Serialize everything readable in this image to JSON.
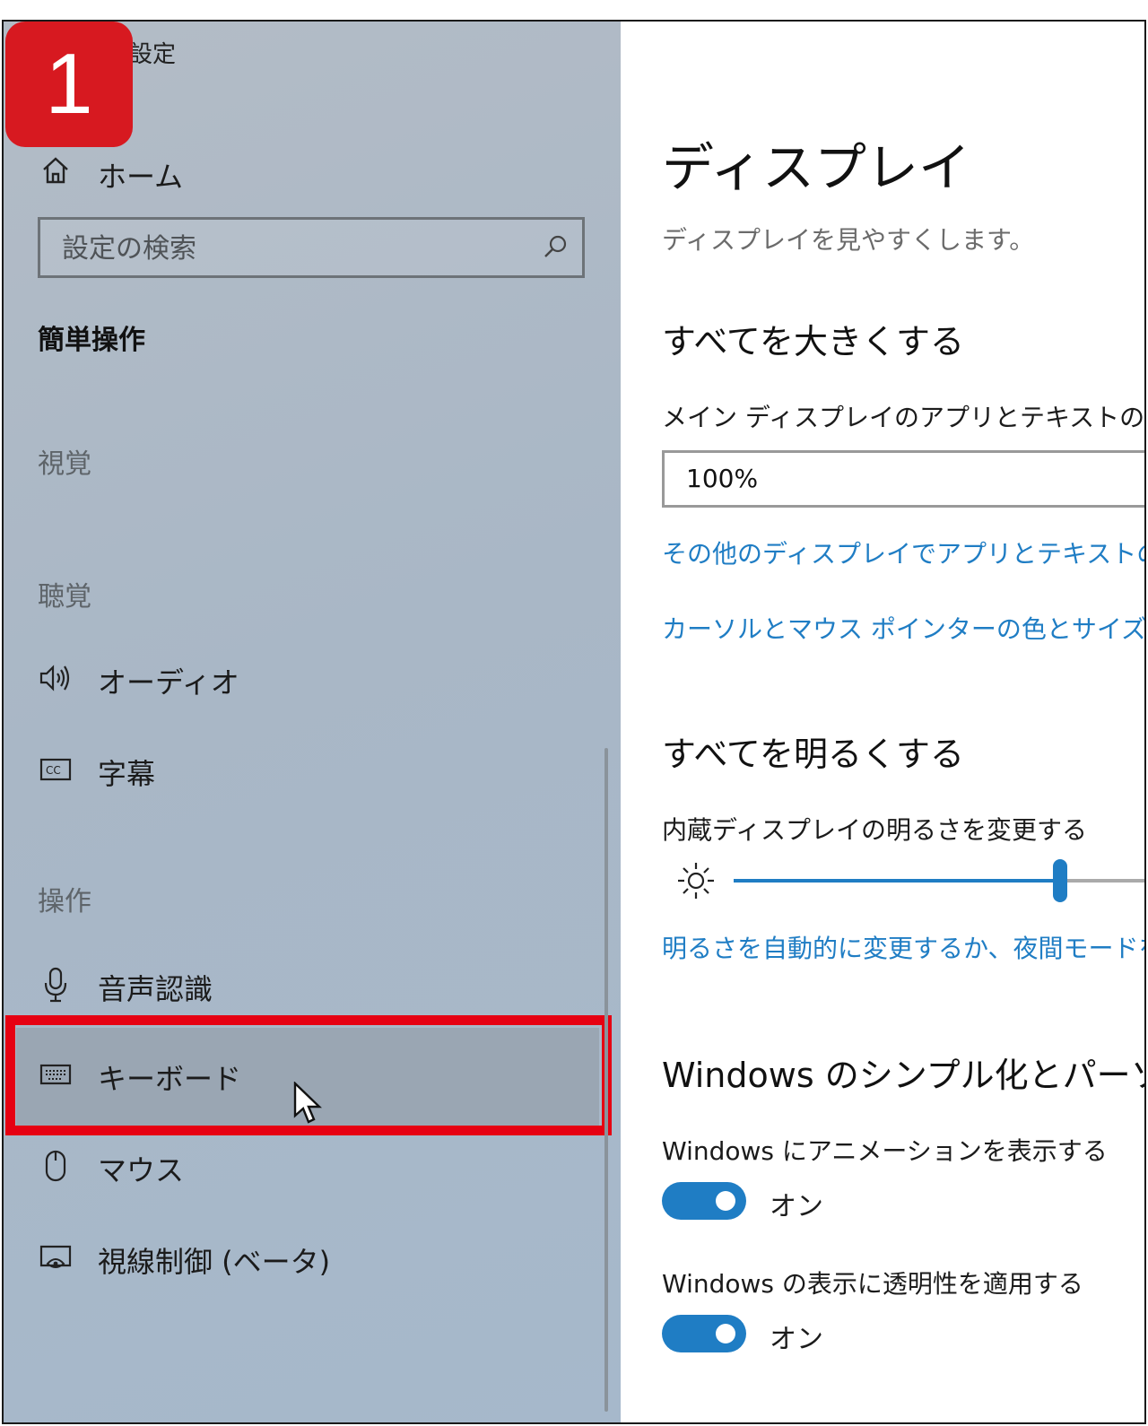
{
  "badge": {
    "number": "1"
  },
  "sidebar": {
    "app_title": "設定",
    "home_label": "ホーム",
    "search_placeholder": "設定の検索",
    "section_title": "簡単操作",
    "groups": {
      "vision": "視覚",
      "hearing": "聴覚",
      "interaction": "操作"
    },
    "items": {
      "audio": "オーディオ",
      "captions": "字幕",
      "speech": "音声認識",
      "keyboard": "キーボード",
      "mouse": "マウス",
      "eye_control": "視線制御 (ベータ)"
    },
    "selected_item": "keyboard"
  },
  "content": {
    "title": "ディスプレイ",
    "subtitle": "ディスプレイを見やすくします。",
    "make_bigger": {
      "heading": "すべてを大きくする",
      "label": "メイン ディスプレイのアプリとテキストのサイズ",
      "value": "100%",
      "link1": "その他のディスプレイでアプリとテキストのサイ",
      "link2": "カーソルとマウス ポインターの色とサイズを変"
    },
    "make_brighter": {
      "heading": "すべてを明るくする",
      "label": "内蔵ディスプレイの明るさを変更する",
      "brightness": 0.7,
      "link": "明るさを自動的に変更するか、夜間モードを"
    },
    "simplify": {
      "heading": "Windows のシンプル化とパーソナ",
      "animations_label": "Windows にアニメーションを表示する",
      "animations_state": "オン",
      "transparency_label": "Windows の表示に透明性を適用する",
      "transparency_state": "オン"
    }
  },
  "colors": {
    "accent": "#1f7dc4",
    "highlight": "#e60012",
    "badge": "#d71920"
  }
}
